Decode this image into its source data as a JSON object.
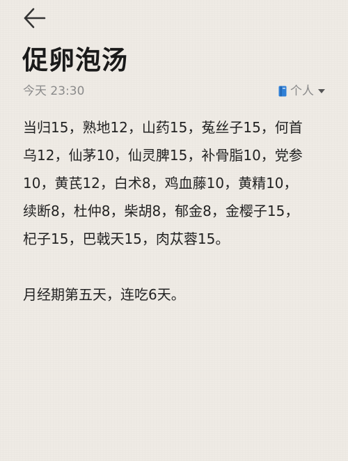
{
  "header": {
    "back_icon": "arrow-left-icon"
  },
  "note": {
    "title": "促卵泡汤",
    "timestamp": "今天 23:30",
    "folder": {
      "icon": "notebook-icon",
      "label": "个人",
      "accent": "#2f7fd6"
    },
    "body_lines": [
      "当归15，熟地12，山药15，菟丝子15，何首",
      "乌12，仙茅10，仙灵脾15，补骨脂10，党参",
      "10，黄芪12，白术8，鸡血藤10，黄精10，",
      "续断8，杜仲8，柴胡8，郁金8，金樱子15，",
      "杞子15，巴戟天15，肉苁蓉15。",
      "",
      "月经期第五天，连吃6天。"
    ]
  }
}
